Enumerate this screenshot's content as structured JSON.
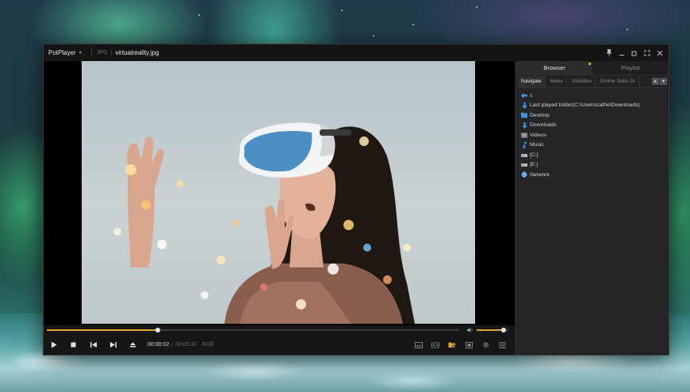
{
  "player": {
    "app_menu_label": "PotPlayer",
    "file_type": "JPG",
    "title_divider": "|",
    "file_name": "virtualreality.jpg"
  },
  "playback": {
    "current_time": "00:00:02",
    "time_separator": "/",
    "total_time": "00:05:30",
    "color_format": "RGB",
    "progress": 0.27,
    "volume": 0.85
  },
  "panel": {
    "tabs": [
      {
        "label": "Browser",
        "active": true
      },
      {
        "label": "Playlist",
        "active": false
      }
    ],
    "sub_tabs": [
      {
        "label": "Navigate",
        "active": true
      },
      {
        "label": "Menu",
        "active": false
      },
      {
        "label": "Subtitles",
        "active": false
      },
      {
        "label": "Online Subs Dr",
        "active": false
      }
    ],
    "nav_items": [
      {
        "label": "c",
        "icon": "back-arrow-icon"
      },
      {
        "label": "Last played folder(C:\\Users\\cathe\\Downloads)",
        "icon": "download-arrow-icon"
      },
      {
        "label": "Desktop",
        "icon": "desktop-folder-icon"
      },
      {
        "label": "Downloads",
        "icon": "download-arrow-icon"
      },
      {
        "label": "Videos",
        "icon": "film-icon"
      },
      {
        "label": "Music",
        "icon": "music-note-icon"
      },
      {
        "label": "[C:]",
        "icon": "drive-icon"
      },
      {
        "label": "[E:]",
        "icon": "drive-icon"
      },
      {
        "label": "Network",
        "icon": "network-globe-icon"
      }
    ]
  },
  "colors": {
    "accent": "#d8a52e",
    "window_bg": "#1b1b1b",
    "panel_bg": "#252525",
    "icon_blue": "#3f8fe8"
  }
}
